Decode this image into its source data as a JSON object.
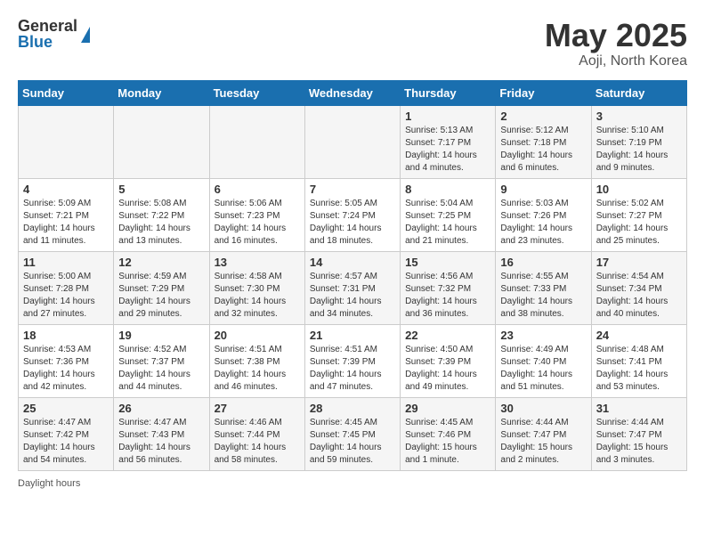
{
  "logo": {
    "general": "General",
    "blue": "Blue"
  },
  "title": "May 2025",
  "subtitle": "Aoji, North Korea",
  "headers": [
    "Sunday",
    "Monday",
    "Tuesday",
    "Wednesday",
    "Thursday",
    "Friday",
    "Saturday"
  ],
  "rows": [
    [
      {
        "day": "",
        "info": ""
      },
      {
        "day": "",
        "info": ""
      },
      {
        "day": "",
        "info": ""
      },
      {
        "day": "",
        "info": ""
      },
      {
        "day": "1",
        "info": "Sunrise: 5:13 AM\nSunset: 7:17 PM\nDaylight: 14 hours\nand 4 minutes."
      },
      {
        "day": "2",
        "info": "Sunrise: 5:12 AM\nSunset: 7:18 PM\nDaylight: 14 hours\nand 6 minutes."
      },
      {
        "day": "3",
        "info": "Sunrise: 5:10 AM\nSunset: 7:19 PM\nDaylight: 14 hours\nand 9 minutes."
      }
    ],
    [
      {
        "day": "4",
        "info": "Sunrise: 5:09 AM\nSunset: 7:21 PM\nDaylight: 14 hours\nand 11 minutes."
      },
      {
        "day": "5",
        "info": "Sunrise: 5:08 AM\nSunset: 7:22 PM\nDaylight: 14 hours\nand 13 minutes."
      },
      {
        "day": "6",
        "info": "Sunrise: 5:06 AM\nSunset: 7:23 PM\nDaylight: 14 hours\nand 16 minutes."
      },
      {
        "day": "7",
        "info": "Sunrise: 5:05 AM\nSunset: 7:24 PM\nDaylight: 14 hours\nand 18 minutes."
      },
      {
        "day": "8",
        "info": "Sunrise: 5:04 AM\nSunset: 7:25 PM\nDaylight: 14 hours\nand 21 minutes."
      },
      {
        "day": "9",
        "info": "Sunrise: 5:03 AM\nSunset: 7:26 PM\nDaylight: 14 hours\nand 23 minutes."
      },
      {
        "day": "10",
        "info": "Sunrise: 5:02 AM\nSunset: 7:27 PM\nDaylight: 14 hours\nand 25 minutes."
      }
    ],
    [
      {
        "day": "11",
        "info": "Sunrise: 5:00 AM\nSunset: 7:28 PM\nDaylight: 14 hours\nand 27 minutes."
      },
      {
        "day": "12",
        "info": "Sunrise: 4:59 AM\nSunset: 7:29 PM\nDaylight: 14 hours\nand 29 minutes."
      },
      {
        "day": "13",
        "info": "Sunrise: 4:58 AM\nSunset: 7:30 PM\nDaylight: 14 hours\nand 32 minutes."
      },
      {
        "day": "14",
        "info": "Sunrise: 4:57 AM\nSunset: 7:31 PM\nDaylight: 14 hours\nand 34 minutes."
      },
      {
        "day": "15",
        "info": "Sunrise: 4:56 AM\nSunset: 7:32 PM\nDaylight: 14 hours\nand 36 minutes."
      },
      {
        "day": "16",
        "info": "Sunrise: 4:55 AM\nSunset: 7:33 PM\nDaylight: 14 hours\nand 38 minutes."
      },
      {
        "day": "17",
        "info": "Sunrise: 4:54 AM\nSunset: 7:34 PM\nDaylight: 14 hours\nand 40 minutes."
      }
    ],
    [
      {
        "day": "18",
        "info": "Sunrise: 4:53 AM\nSunset: 7:36 PM\nDaylight: 14 hours\nand 42 minutes."
      },
      {
        "day": "19",
        "info": "Sunrise: 4:52 AM\nSunset: 7:37 PM\nDaylight: 14 hours\nand 44 minutes."
      },
      {
        "day": "20",
        "info": "Sunrise: 4:51 AM\nSunset: 7:38 PM\nDaylight: 14 hours\nand 46 minutes."
      },
      {
        "day": "21",
        "info": "Sunrise: 4:51 AM\nSunset: 7:39 PM\nDaylight: 14 hours\nand 47 minutes."
      },
      {
        "day": "22",
        "info": "Sunrise: 4:50 AM\nSunset: 7:39 PM\nDaylight: 14 hours\nand 49 minutes."
      },
      {
        "day": "23",
        "info": "Sunrise: 4:49 AM\nSunset: 7:40 PM\nDaylight: 14 hours\nand 51 minutes."
      },
      {
        "day": "24",
        "info": "Sunrise: 4:48 AM\nSunset: 7:41 PM\nDaylight: 14 hours\nand 53 minutes."
      }
    ],
    [
      {
        "day": "25",
        "info": "Sunrise: 4:47 AM\nSunset: 7:42 PM\nDaylight: 14 hours\nand 54 minutes."
      },
      {
        "day": "26",
        "info": "Sunrise: 4:47 AM\nSunset: 7:43 PM\nDaylight: 14 hours\nand 56 minutes."
      },
      {
        "day": "27",
        "info": "Sunrise: 4:46 AM\nSunset: 7:44 PM\nDaylight: 14 hours\nand 58 minutes."
      },
      {
        "day": "28",
        "info": "Sunrise: 4:45 AM\nSunset: 7:45 PM\nDaylight: 14 hours\nand 59 minutes."
      },
      {
        "day": "29",
        "info": "Sunrise: 4:45 AM\nSunset: 7:46 PM\nDaylight: 15 hours\nand 1 minute."
      },
      {
        "day": "30",
        "info": "Sunrise: 4:44 AM\nSunset: 7:47 PM\nDaylight: 15 hours\nand 2 minutes."
      },
      {
        "day": "31",
        "info": "Sunrise: 4:44 AM\nSunset: 7:47 PM\nDaylight: 15 hours\nand 3 minutes."
      }
    ]
  ],
  "footer": "Daylight hours"
}
